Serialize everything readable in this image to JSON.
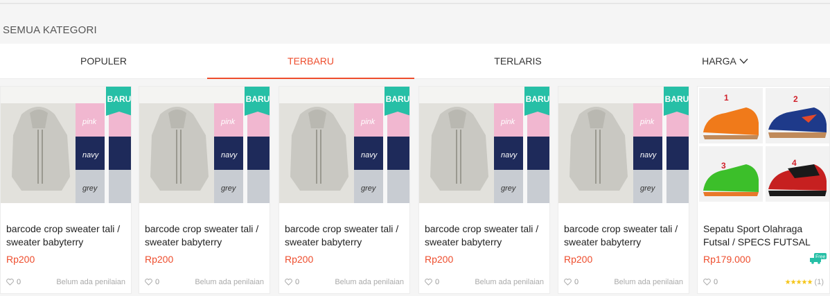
{
  "section": {
    "title": "SEMUA KATEGORI"
  },
  "tabs": [
    {
      "label": "POPULER"
    },
    {
      "label": "TERBARU"
    },
    {
      "label": "TERLARIS"
    },
    {
      "label": "HARGA"
    }
  ],
  "active_tab": "TERBARU",
  "colors": {
    "accent": "#ee4d2d",
    "badge": "#26bfa6",
    "star": "#f5c518"
  },
  "products": [
    {
      "badge": "BARU",
      "title": "barcode crop sweater tali / sweater babyterry",
      "price": "Rp200",
      "likes": "0",
      "rating_text": "Belum ada penilaian",
      "image_labels": [
        "pink",
        "navy",
        "grey"
      ]
    },
    {
      "badge": "BARU",
      "title": "barcode crop sweater tali / sweater babyterry",
      "price": "Rp200",
      "likes": "0",
      "rating_text": "Belum ada penilaian",
      "image_labels": [
        "pink",
        "navy",
        "grey"
      ]
    },
    {
      "badge": "BARU",
      "title": "barcode crop sweater tali / sweater babyterry",
      "price": "Rp200",
      "likes": "0",
      "rating_text": "Belum ada penilaian",
      "image_labels": [
        "pink",
        "navy",
        "grey"
      ]
    },
    {
      "badge": "BARU",
      "title": "barcode crop sweater tali / sweater babyterry",
      "price": "Rp200",
      "likes": "0",
      "rating_text": "Belum ada penilaian",
      "image_labels": [
        "pink",
        "navy",
        "grey"
      ]
    },
    {
      "badge": "BARU",
      "title": "barcode crop sweater tali / sweater babyterry",
      "price": "Rp200",
      "likes": "0",
      "rating_text": "Belum ada penilaian",
      "image_labels": [
        "pink",
        "navy",
        "grey"
      ]
    },
    {
      "badge": "",
      "title": "Sepatu Sport Olahraga Futsal / SPECS FUTSAL",
      "price": "Rp179.000",
      "likes": "0",
      "stars": "★★★★★",
      "rating_count": "(1)",
      "free_shipping": "Free",
      "image_labels": [
        "1",
        "2",
        "3",
        "4"
      ]
    }
  ]
}
